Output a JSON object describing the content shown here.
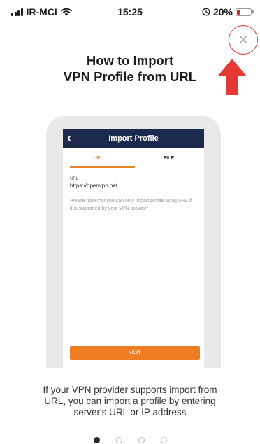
{
  "status_bar": {
    "carrier": "IR-MCI",
    "time": "15:25",
    "battery_percent": "20%",
    "battery_level": 0.2
  },
  "heading": {
    "line1": "How to Import",
    "line2": "VPN Profile from URL"
  },
  "mockup": {
    "title": "Import Profile",
    "tabs": [
      "URL",
      "FILE"
    ],
    "active_tab": "URL",
    "url_label": "URL",
    "url_value": "https://openvpn.net",
    "note": "Please note that you can only import profile using URL if it is supported by your VPN provider",
    "next_label": "NEXT"
  },
  "description": {
    "line1": "If your VPN provider supports import from",
    "line2": "URL, you can import a profile by entering",
    "line3": "server's URL or IP address"
  },
  "pagination": {
    "count": 4,
    "active": 0
  },
  "icons": {
    "close": "close-icon",
    "back": "chevron-left-icon",
    "wifi": "wifi-icon",
    "signal": "cellular-signal-icon",
    "alarm": "alarm-icon",
    "battery": "battery-icon",
    "annotation": "arrow-up-icon"
  },
  "colors": {
    "accent": "#ee7d23",
    "header": "#1c2a4d",
    "annotation": "#e53935",
    "battery_low": "#e02020"
  }
}
